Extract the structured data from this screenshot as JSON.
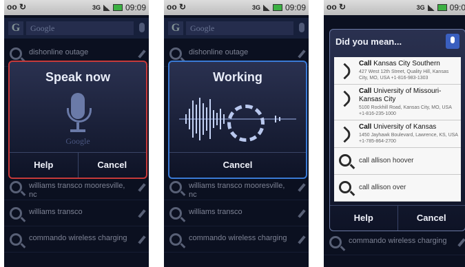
{
  "status": {
    "network": "3G",
    "time": "09:09",
    "time_cut": "09:0"
  },
  "search": {
    "placeholder": "Google",
    "logo": "G"
  },
  "suggestions": [
    "dishonline outage",
    "williams transco mooresville, nc",
    "williams transco",
    "commando wireless charging"
  ],
  "panel1": {
    "title": "Speak now",
    "logo": "Google",
    "help": "Help",
    "cancel": "Cancel"
  },
  "panel2": {
    "title": "Working",
    "cancel": "Cancel"
  },
  "panel3": {
    "title": "Did you mean...",
    "results": [
      {
        "prefix": "Call",
        "name": "Kansas City Southern",
        "address": "427 West 12th Street, Quality Hill, Kansas City, MO, USA +1-816-983-1303"
      },
      {
        "prefix": "Call",
        "name": "University of Missouri-Kansas City",
        "address": "5100 Rockhill Road, Kansas City, MO, USA +1-816-235-1000"
      },
      {
        "prefix": "Call",
        "name": "University of Kansas",
        "address": "1450 Jayhawk Boulevard, Lawrence, KS, USA +1-785-864-2700"
      }
    ],
    "queries": [
      "call allison hoover",
      "call allison over"
    ],
    "help": "Help",
    "cancel": "Cancel",
    "bottom_suggestion": "commando wireless charging"
  }
}
